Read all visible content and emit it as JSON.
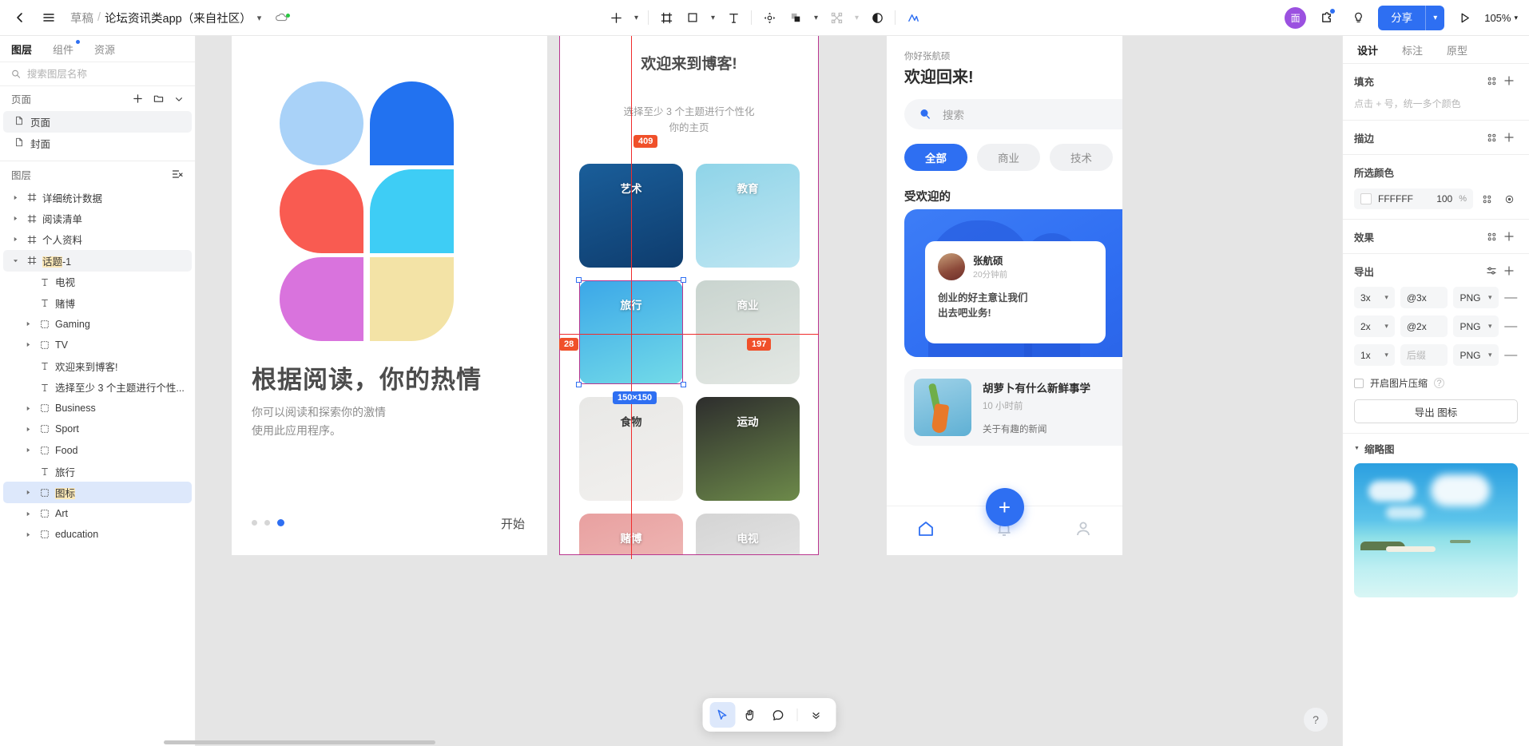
{
  "topbar": {
    "back_icon": "chevron-left-icon",
    "menu_icon": "hamburger-icon",
    "breadcrumb_draft": "草稿",
    "breadcrumb_sep": "/",
    "breadcrumb_file": "论坛资讯类app（来自社区）",
    "cloud_icon": "cloud-sync-icon",
    "tools": [
      {
        "name": "add-icon",
        "glyph": "+"
      },
      {
        "name": "frame-icon",
        "glyph": "frame"
      },
      {
        "name": "rectangle-icon",
        "glyph": "rect"
      },
      {
        "name": "text-icon",
        "glyph": "T"
      },
      {
        "name": "move-icon",
        "glyph": "move"
      },
      {
        "name": "boolean-icon",
        "glyph": "bool"
      },
      {
        "name": "vector-icon",
        "glyph": "vector"
      },
      {
        "name": "mask-icon",
        "glyph": "mask"
      },
      {
        "name": "ai-icon",
        "glyph": "ai"
      }
    ],
    "avatar_text": "面",
    "plugin_icon": "plugin-icon",
    "idea_icon": "lightbulb-icon",
    "share_label": "分享",
    "present_icon": "play-icon",
    "zoom_label": "105%"
  },
  "left_panel": {
    "tabs": [
      {
        "label": "图层",
        "active": true,
        "dot": false
      },
      {
        "label": "组件",
        "active": false,
        "dot": true
      },
      {
        "label": "资源",
        "active": false,
        "dot": false
      }
    ],
    "search_placeholder": "搜索图层名称",
    "pages_title": "页面",
    "pages": [
      {
        "label": "页面",
        "selected": true
      },
      {
        "label": "封面",
        "selected": false
      }
    ],
    "layers_title": "图层",
    "layers": [
      {
        "label": "话题-1",
        "type": "frame",
        "indent": 0,
        "arrow": "right",
        "selected": false,
        "hidden_sample": true
      },
      {
        "label": "详细统计数据",
        "type": "frame",
        "indent": 0,
        "arrow": "right",
        "selected": false
      },
      {
        "label": "阅读清单",
        "type": "frame",
        "indent": 0,
        "arrow": "right",
        "selected": false
      },
      {
        "label": "个人资料",
        "type": "frame",
        "indent": 0,
        "arrow": "right",
        "selected": false
      },
      {
        "label": "话题-1",
        "type": "frame",
        "indent": 0,
        "arrow": "down",
        "selected": true,
        "highlight": "话题"
      },
      {
        "label": "电视",
        "type": "text",
        "indent": 1,
        "arrow": "none",
        "selected": false
      },
      {
        "label": "赌博",
        "type": "text",
        "indent": 1,
        "arrow": "none",
        "selected": false
      },
      {
        "label": "Gaming",
        "type": "group",
        "indent": 1,
        "arrow": "right",
        "selected": false
      },
      {
        "label": "TV",
        "type": "group",
        "indent": 1,
        "arrow": "right",
        "selected": false
      },
      {
        "label": "欢迎来到博客!",
        "type": "text",
        "indent": 1,
        "arrow": "none",
        "selected": false
      },
      {
        "label": "选择至少 3 个主题进行个性...",
        "type": "text",
        "indent": 1,
        "arrow": "none",
        "selected": false
      },
      {
        "label": "Business",
        "type": "group",
        "indent": 1,
        "arrow": "right",
        "selected": false
      },
      {
        "label": "Sport",
        "type": "group",
        "indent": 1,
        "arrow": "right",
        "selected": false
      },
      {
        "label": "Food",
        "type": "group",
        "indent": 1,
        "arrow": "right",
        "selected": false
      },
      {
        "label": "旅行",
        "type": "text",
        "indent": 1,
        "arrow": "none",
        "selected": false
      },
      {
        "label": "图标",
        "type": "group",
        "indent": 1,
        "arrow": "right",
        "selected": false,
        "selected_blue": true,
        "highlight": "图标"
      },
      {
        "label": "Art",
        "type": "group",
        "indent": 1,
        "arrow": "right",
        "selected": false
      },
      {
        "label": "education",
        "type": "group",
        "indent": 1,
        "arrow": "right",
        "selected": false
      }
    ]
  },
  "canvas": {
    "artboard1": {
      "title": "根据阅读，你的热情",
      "subtitle": "你可以阅读和探索你的激情\n使用此应用程序。",
      "start_label": "开始",
      "dots": 3,
      "active_dot": 2,
      "logo_colors": [
        "#a9d2f8",
        "#2272f0",
        "#f95b51",
        "#3ecdf5",
        "#d973dd",
        "#f3e3a6"
      ]
    },
    "artboard2": {
      "title": "欢迎来到博客!",
      "subtitle": "选择至少 3 个主题进行个性化\n你的主页",
      "topics": [
        {
          "label": "艺术",
          "color1": "#1a5e9a",
          "color2": "#0e3c6d",
          "dark": false
        },
        {
          "label": "教育",
          "color1": "#8fd4e8",
          "color2": "#bfe6f2",
          "dark": false
        },
        {
          "label": "旅行",
          "color1": "#3ba7e8",
          "color2": "#73dbe8",
          "dark": false
        },
        {
          "label": "商业",
          "color1": "#c9d4cf",
          "color2": "#e4e8e4",
          "dark": false
        },
        {
          "label": "食物",
          "color1": "#e8e8e6",
          "color2": "#f2f0ee",
          "dark": true
        },
        {
          "label": "运动",
          "color1": "#2d2d2d",
          "color2": "#6d8a4a",
          "dark": false
        },
        {
          "label": "赌博",
          "color1": "#e8a0a0",
          "color2": "#f2c4c0",
          "dark": false
        },
        {
          "label": "电视",
          "color1": "#d4d4d4",
          "color2": "#ededed",
          "dark": false
        }
      ]
    },
    "artboard3": {
      "greeting": "你好张航硕",
      "welcome": "欢迎回来!",
      "search_placeholder": "搜索",
      "chips": [
        {
          "label": "全部",
          "active": true
        },
        {
          "label": "商业",
          "active": false
        },
        {
          "label": "技术",
          "active": false
        }
      ],
      "section_title": "受欢迎的",
      "hero": {
        "author": "张航硕",
        "time": "20分钟前",
        "body": "创业的好主意让我们\n出去吧业务!",
        "fire_icon": "🔥"
      },
      "list_item": {
        "title": "胡萝卜有什么新鲜事学",
        "time": "10 小时前",
        "desc": "关于有趣的新闻"
      },
      "tabbar": [
        {
          "name": "home-icon",
          "active": true
        },
        {
          "name": "bell-icon",
          "active": false
        },
        {
          "name": "person-icon",
          "active": false
        }
      ],
      "fab_label": "+"
    },
    "measurements": {
      "top_badge": "409",
      "left_badge": "28",
      "right_badge": "197",
      "size_badge": "150×150"
    }
  },
  "float_toolbar": {
    "items": [
      {
        "name": "cursor-icon",
        "active": true
      },
      {
        "name": "hand-icon",
        "active": false
      },
      {
        "name": "comment-icon",
        "active": false
      },
      {
        "name": "more-chevrons-icon",
        "active": false
      }
    ]
  },
  "help_button": {
    "label": "?"
  },
  "right_panel": {
    "tabs": [
      {
        "label": "设计",
        "active": true
      },
      {
        "label": "标注",
        "active": false
      },
      {
        "label": "原型",
        "active": false
      }
    ],
    "fill": {
      "title": "填充",
      "hint": "点击 + 号，统一多个颜色"
    },
    "stroke": {
      "title": "描边"
    },
    "selected_color": {
      "title": "所选颜色",
      "hex": "FFFFFF",
      "opacity": "100",
      "percent": "%"
    },
    "effects": {
      "title": "效果"
    },
    "export": {
      "title": "导出",
      "rows": [
        {
          "scale": "3x",
          "suffix": "@3x",
          "suffix_is_placeholder": false,
          "format": "PNG"
        },
        {
          "scale": "2x",
          "suffix": "@2x",
          "suffix_is_placeholder": false,
          "format": "PNG"
        },
        {
          "scale": "1x",
          "suffix": "后缀",
          "suffix_is_placeholder": true,
          "format": "PNG"
        }
      ],
      "compress_label": "开启图片压缩",
      "button_label": "导出 图标"
    },
    "thumbnail": {
      "title": "缩略图"
    }
  }
}
